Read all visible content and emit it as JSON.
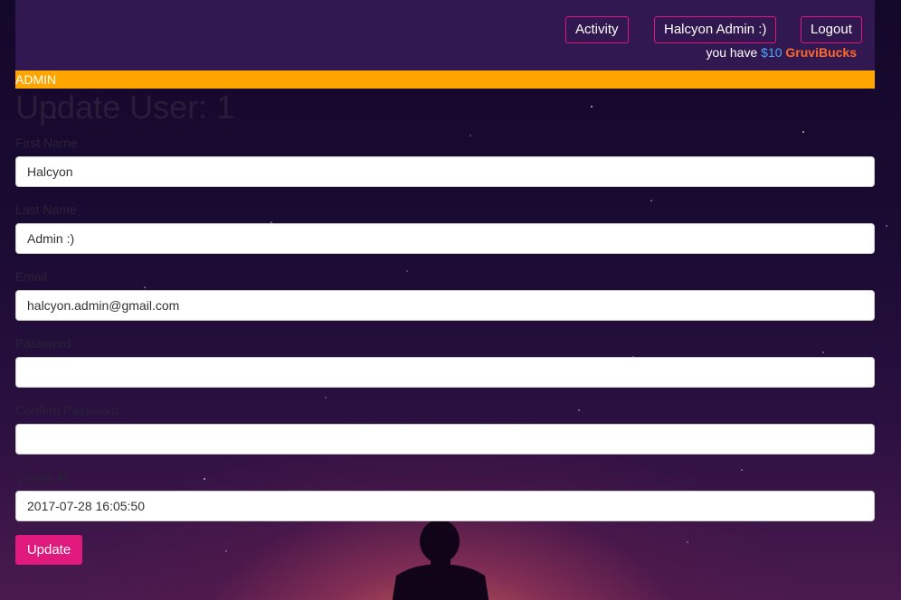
{
  "nav": {
    "activity_label": "Activity",
    "user_label": "Halcyon Admin :)",
    "logout_label": "Logout",
    "bucks_prefix": "you have",
    "bucks_amount": "$10",
    "bucks_currency": "GruviBucks"
  },
  "admin_bar": {
    "label": "ADMIN"
  },
  "page": {
    "title": "Update User: 1"
  },
  "form": {
    "first_name": {
      "label": "First Name",
      "value": "Halcyon"
    },
    "last_name": {
      "label": "Last Name",
      "value": "Admin :)"
    },
    "email": {
      "label": "Email",
      "value": "halcyon.admin@gmail.com"
    },
    "password": {
      "label": "Password",
      "value": ""
    },
    "confirm_password": {
      "label": "Confirm Password",
      "value": ""
    },
    "create_at": {
      "label": "Create At",
      "value": "2017-07-28 16:05:50"
    },
    "submit_label": "Update"
  },
  "colors": {
    "navbar_bg": "#321850",
    "accent_pink": "#e0187e",
    "admin_bar": "#ffa500",
    "bucks_amount": "#4aa8ff",
    "bucks_currency": "#ff6a2c"
  }
}
